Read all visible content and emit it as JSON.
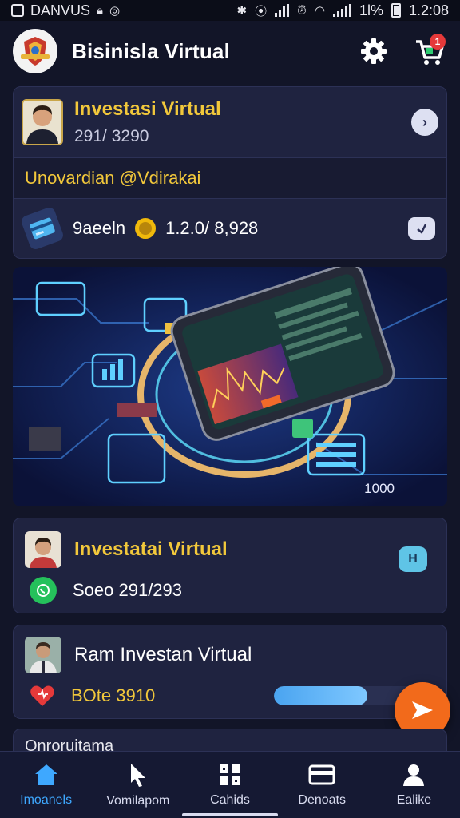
{
  "status_bar": {
    "carrier": "DANVUS",
    "percent": "1l%",
    "time": "1.2:08"
  },
  "header": {
    "title": "Bisinisla Virtual",
    "cart_badge": "1"
  },
  "card_investment": {
    "title": "Investasi Virtual",
    "subtitle": "291/ 3290",
    "banner": "Unovardian @Vdirakai",
    "row_label": "9aeeln",
    "row_value": "1.2.0/ 8,928"
  },
  "hero": {
    "number": "1000"
  },
  "card_second": {
    "title": "Investatai Virtual",
    "subtitle": "Soeo 291/293",
    "button_label": "H"
  },
  "card_third": {
    "title": "Ram Investan Virtual",
    "subtitle": "BOte 3910",
    "progress": 0.6
  },
  "card_partial": {
    "text": "Onroruitama"
  },
  "bottom_nav": {
    "items": [
      {
        "label": "Imoanels"
      },
      {
        "label": "Vomilapom"
      },
      {
        "label": "Cahids"
      },
      {
        "label": "Denoats"
      },
      {
        "label": "Ealike"
      }
    ]
  },
  "colors": {
    "accent_gold": "#f2c83b",
    "background": "#121528",
    "card": "#1f2340",
    "active_nav": "#3ea8ff",
    "fab": "#f26a1b"
  },
  "icons": {
    "header": [
      "app-logo",
      "gear-icon",
      "cart-icon"
    ],
    "nav": [
      "home-icon",
      "cursor-icon",
      "grid-icon",
      "wallet-card-icon",
      "person-icon"
    ]
  }
}
